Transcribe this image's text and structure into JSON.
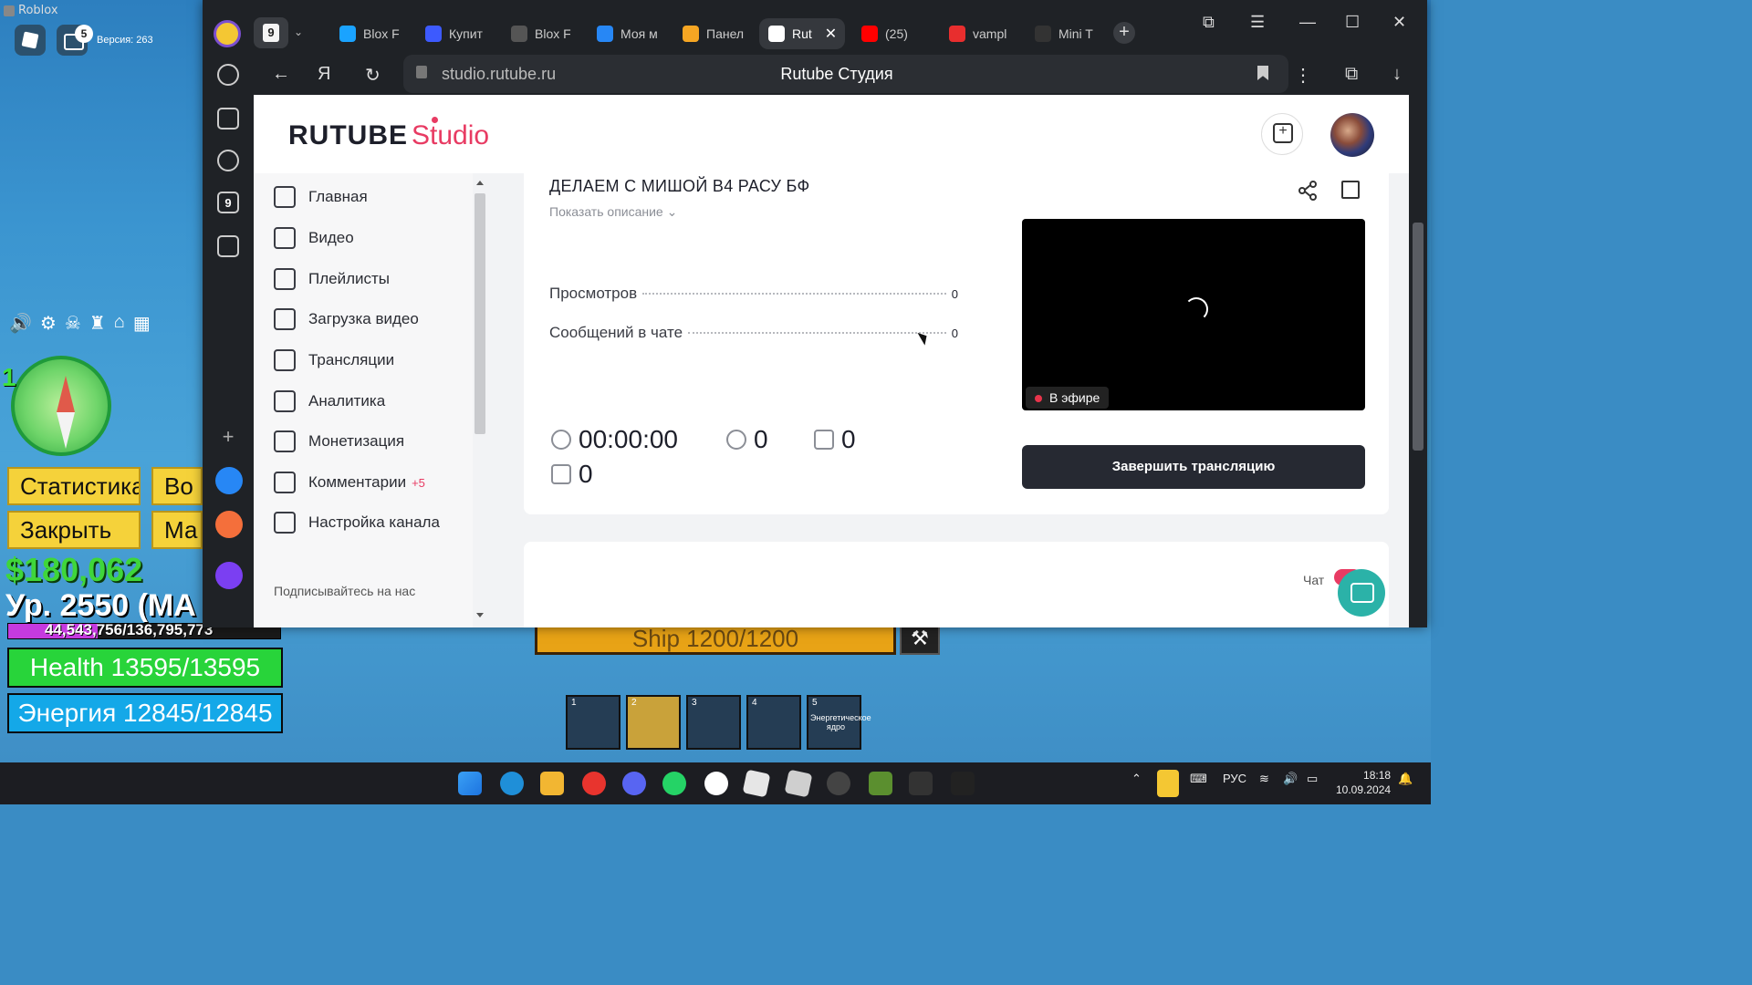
{
  "game": {
    "window_title": "Roblox",
    "chat_badge": "5",
    "version": "Версия: 263",
    "level_small": "1",
    "buttons": [
      "Статистика",
      "Во",
      "Закрыть",
      "Ма"
    ],
    "money": "$180,062",
    "level": "Ур. 2550 (МА",
    "xp": "44,543,756/136,795,773",
    "health": "Health 13595/13595",
    "energy": "Энергия 12845/12845",
    "ship": "Ship 1200/1200",
    "slots": [
      {
        "n": "1",
        "t": ""
      },
      {
        "n": "2",
        "t": ""
      },
      {
        "n": "3",
        "t": ""
      },
      {
        "n": "4",
        "t": ""
      },
      {
        "n": "5",
        "t": "Энергетическое ядро"
      }
    ]
  },
  "browser": {
    "tab_group_count": "9",
    "tabs": [
      {
        "label": "Blox F",
        "color": "#1aa3ff"
      },
      {
        "label": "Купит",
        "color": "#3d5afe"
      },
      {
        "label": "Blox F",
        "color": "#444"
      },
      {
        "label": "Моя м",
        "color": "#2787f5"
      },
      {
        "label": "Панел",
        "color": "#f5a623"
      },
      {
        "label": "Rut",
        "color": "#111"
      },
      {
        "label": "(25)",
        "color": "#ff0000"
      },
      {
        "label": "vampl",
        "color": "#e82e2e"
      },
      {
        "label": "Mini T",
        "color": "#222"
      }
    ],
    "url": "studio.rutube.ru",
    "page_title": "Rutube Студия",
    "sidebar_tab_count": "9"
  },
  "studio": {
    "logo_main": "RUTUBE",
    "logo_studio": "Studio",
    "nav": [
      {
        "label": "Главная",
        "extra": ""
      },
      {
        "label": "Видео",
        "extra": ""
      },
      {
        "label": "Плейлисты",
        "extra": ""
      },
      {
        "label": "Загрузка видео",
        "extra": ""
      },
      {
        "label": "Трансляции",
        "extra": ""
      },
      {
        "label": "Аналитика",
        "extra": ""
      },
      {
        "label": "Монетизация",
        "extra": ""
      },
      {
        "label": "Комментарии",
        "extra": "+5"
      },
      {
        "label": "Настройка канала",
        "extra": ""
      }
    ],
    "follow": "Подписывайтесь на нас",
    "stream": {
      "title": "ДЕЛАЕМ С МИШОЙ В4 РАСУ БФ",
      "show_description": "Показать описание",
      "views_label": "Просмотров",
      "views_value": "0",
      "chat_label": "Сообщений в чате",
      "chat_value": "0",
      "duration": "00:00:00",
      "viewers": "0",
      "likes": "0",
      "dislikes": "0",
      "live_badge": "В эфире",
      "end_button": "Завершить трансляцию",
      "chat_toggle_label": "Чат"
    }
  },
  "taskbar": {
    "lang": "РУС",
    "time": "18:18",
    "date": "10.09.2024"
  }
}
